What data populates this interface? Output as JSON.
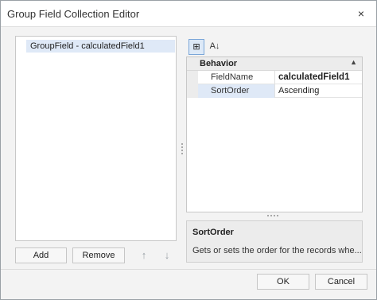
{
  "window": {
    "title": "Group Field Collection Editor",
    "close_icon": "×"
  },
  "list": {
    "items": [
      "GroupField - calculatedField1"
    ]
  },
  "left_buttons": {
    "add": "Add",
    "remove": "Remove",
    "up_icon": "↑",
    "down_icon": "↓"
  },
  "property_grid": {
    "toolbar": {
      "categorized_icon": "⊞",
      "alphabetical_icon": "A↓"
    },
    "category": {
      "label": "Behavior",
      "toggle": "▲"
    },
    "properties": [
      {
        "name": "FieldName",
        "value": "calculatedField1"
      },
      {
        "name": "SortOrder",
        "value": "Ascending"
      }
    ],
    "description": {
      "title": "SortOrder",
      "text": "Gets or sets the order for the records whe..."
    }
  },
  "footer": {
    "ok": "OK",
    "cancel": "Cancel"
  }
}
